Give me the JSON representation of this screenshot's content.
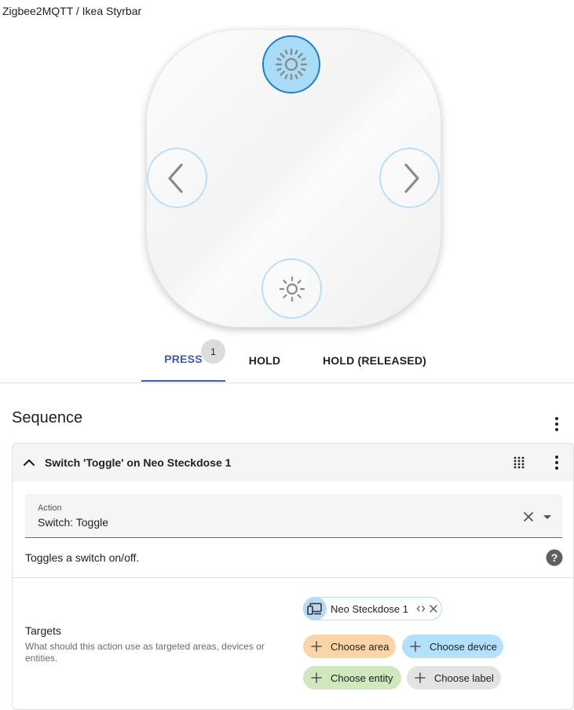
{
  "breadcrumb": "Zigbee2MQTT / Ikea Styrbar",
  "remote": {
    "buttons": [
      {
        "name": "brightness-up",
        "icon": "sun-large-icon",
        "active": true
      },
      {
        "name": "left",
        "icon": "chevron-left-icon",
        "active": false
      },
      {
        "name": "right",
        "icon": "chevron-right-icon",
        "active": false
      },
      {
        "name": "brightness-down",
        "icon": "sun-small-icon",
        "active": false
      }
    ]
  },
  "tabs": [
    {
      "label": "PRESS",
      "active": true,
      "badge": "1"
    },
    {
      "label": "HOLD",
      "active": false
    },
    {
      "label": "HOLD (RELEASED)",
      "active": false
    }
  ],
  "sequence": {
    "title": "Sequence",
    "action_card": {
      "title": "Switch 'Toggle' on Neo Steckdose 1",
      "action_field": {
        "label": "Action",
        "value": "Switch: Toggle"
      },
      "description": "Toggles a switch on/off.",
      "targets": {
        "title": "Targets",
        "description": "What should this action use as targeted areas, devices or entities.",
        "selected": [
          {
            "label": "Neo Steckdose 1",
            "icon": "devices-icon"
          }
        ],
        "choose_area": "Choose area",
        "choose_device": "Choose device",
        "choose_entity": "Choose entity",
        "choose_label": "Choose label"
      }
    }
  },
  "colors": {
    "accent": "#3b5bb8",
    "area_chip": "#fbd5a8",
    "device_chip": "#b3e0fa",
    "entity_chip": "#cfe8bd",
    "label_chip": "#e3e3e3",
    "remote_active": "#a8dcf7"
  }
}
